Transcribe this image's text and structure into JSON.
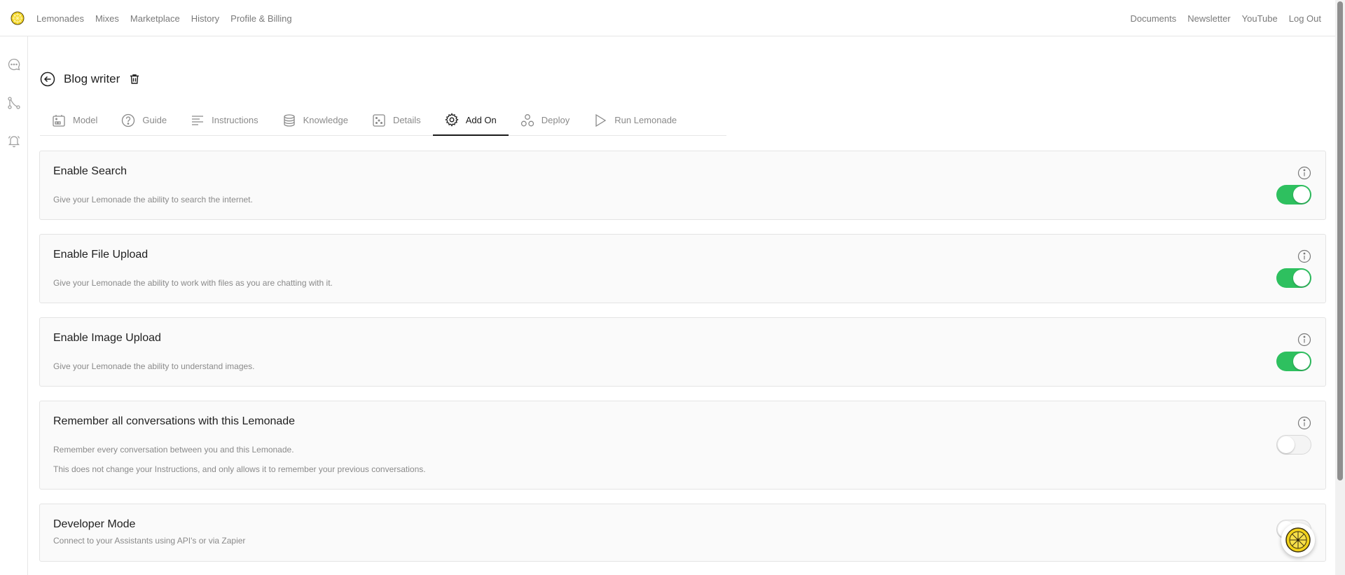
{
  "nav": {
    "left": [
      "Lemonades",
      "Mixes",
      "Marketplace",
      "History",
      "Profile & Billing"
    ],
    "right": [
      "Documents",
      "Newsletter",
      "YouTube",
      "Log Out"
    ]
  },
  "rail": {
    "icons": [
      "chat-bubble-icon",
      "flow-icon",
      "bell-icon"
    ]
  },
  "page": {
    "title": "Blog writer"
  },
  "tabs": [
    {
      "label": "Model",
      "icon": "model-icon",
      "active": false
    },
    {
      "label": "Guide",
      "icon": "question-circle-icon",
      "active": false
    },
    {
      "label": "Instructions",
      "icon": "lines-icon",
      "active": false
    },
    {
      "label": "Knowledge",
      "icon": "database-icon",
      "active": false
    },
    {
      "label": "Details",
      "icon": "dice-icon",
      "active": false
    },
    {
      "label": "Add On",
      "icon": "gear-icon",
      "active": true
    },
    {
      "label": "Deploy",
      "icon": "circles-icon",
      "active": false
    },
    {
      "label": "Run Lemonade",
      "icon": "play-icon",
      "active": false
    }
  ],
  "addons": [
    {
      "title": "Enable Search",
      "desc": [
        "Give your Lemonade the ability to search the internet."
      ],
      "enabled": true
    },
    {
      "title": "Enable File Upload",
      "desc": [
        "Give your Lemonade the ability to work with files as you are chatting with it."
      ],
      "enabled": true
    },
    {
      "title": "Enable Image Upload",
      "desc": [
        "Give your Lemonade the ability to understand images."
      ],
      "enabled": true
    },
    {
      "title": "Remember all conversations with this Lemonade",
      "desc": [
        "Remember every conversation between you and this Lemonade.",
        "This does not change your Instructions, and only allows it to remember your previous conversations."
      ],
      "enabled": false
    },
    {
      "title": "Developer Mode",
      "desc": [
        "Connect to your Assistants using API's or via Zapier"
      ],
      "enabled": false
    }
  ],
  "colors": {
    "toggle_on": "#2ec05f",
    "accent": "#1a1a1a"
  }
}
